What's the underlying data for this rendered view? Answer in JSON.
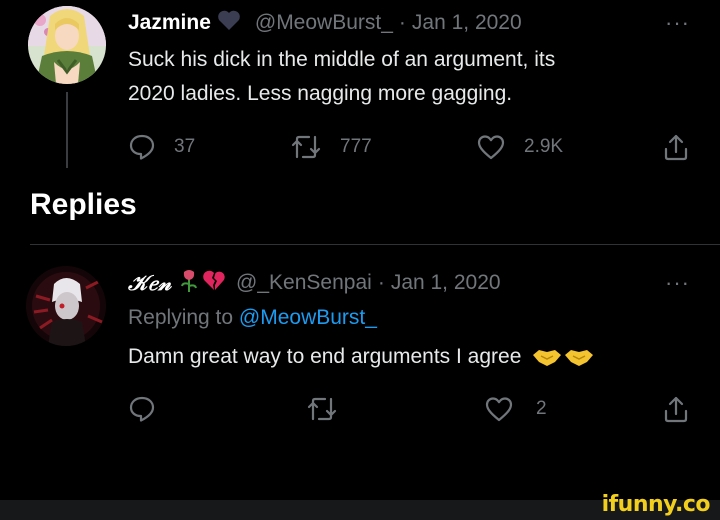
{
  "tweet": {
    "name": "Jazmine",
    "handle": "@MeowBurst_",
    "separator": "·",
    "date": "Jan 1, 2020",
    "more": "···",
    "text_lines": [
      "Suck his dick in the middle of an argument, its",
      "2020 ladies. Less nagging more gagging."
    ],
    "stats": {
      "replies": "37",
      "retweets": "777",
      "likes": "2.9K"
    }
  },
  "replies_heading": "Replies",
  "reply": {
    "name": "𝒦𝑒𝓃",
    "handle": "@_KenSenpai",
    "separator": "·",
    "date": "Jan 1, 2020",
    "more": "···",
    "replying_prefix": "Replying to",
    "replying_to": "@MeowBurst_",
    "text": "Damn great way to end arguments I agree",
    "stats": {
      "likes": "2"
    }
  },
  "watermark": "ifunny.co",
  "colors": {
    "background": "#000000",
    "muted": "#71767b",
    "link": "#1d9bf0",
    "watermark": "#f2cf1d"
  },
  "icons": [
    "reply-icon",
    "retweet-icon",
    "like-icon",
    "share-icon",
    "more-icon",
    "broken-heart-icon",
    "rose-icon",
    "handshake-emoji-icon"
  ]
}
